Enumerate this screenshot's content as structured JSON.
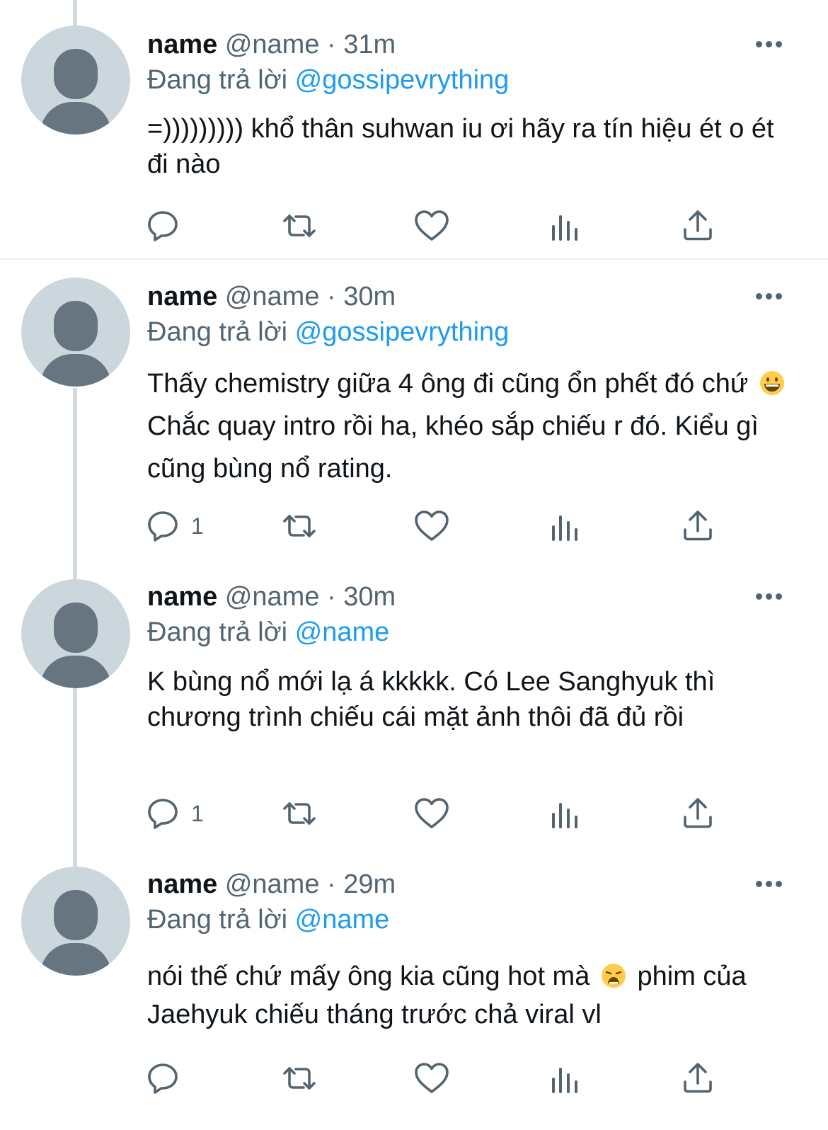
{
  "tweets": [
    {
      "name": "name",
      "handle": "@name",
      "dot": "·",
      "time": "31m",
      "reply_prefix": "Đang trả lời",
      "reply_to": "@gossipevrything",
      "text_parts": [
        "=))))))))) khổ thân suhwan iu ơi hãy ra tín hiệu ét o ét đi nào"
      ],
      "reply_count": ""
    },
    {
      "name": "name",
      "handle": "@name",
      "dot": "·",
      "time": "30m",
      "reply_prefix": "Đang trả lời",
      "reply_to": "@gossipevrything",
      "text_parts": [
        "Thấy chemistry giữa 4 ông đi cũng ổn phết đó chứ",
        "Chắc quay intro rồi ha, khéo sắp chiếu r đó. Kiểu gì cũng bùng nổ rating."
      ],
      "emoji": "grinning-face-emoji",
      "reply_count": "1"
    },
    {
      "name": "name",
      "handle": "@name",
      "dot": "·",
      "time": "30m",
      "reply_prefix": "Đang trả lời",
      "reply_to": "@name",
      "text_parts": [
        "K bùng nổ mới lạ á kkkkk. Có Lee Sanghyuk thì chương trình chiếu cái mặt ảnh thôi đã đủ rồi"
      ],
      "reply_count": "1"
    },
    {
      "name": "name",
      "handle": "@name",
      "dot": "·",
      "time": "29m",
      "reply_prefix": "Đang trả lời",
      "reply_to": "@name",
      "text_parts": [
        "nói thế chứ mấy ông kia cũng hot mà",
        "phim của Jaehyuk chiếu tháng trước chả viral vl"
      ],
      "emoji": "weary-face-emoji",
      "reply_count": ""
    }
  ],
  "icons": {
    "reply": "reply-bubble-icon",
    "retweet": "retweet-icon",
    "like": "heart-icon",
    "views": "analytics-icon",
    "share": "share-icon",
    "more": "more-dots-icon"
  },
  "colors": {
    "mention": "#1d9bf0",
    "secondary": "#536471",
    "avatar_bg": "#ccd6dd",
    "avatar_fg": "#66757f",
    "thread_line": "#cfd9de"
  }
}
